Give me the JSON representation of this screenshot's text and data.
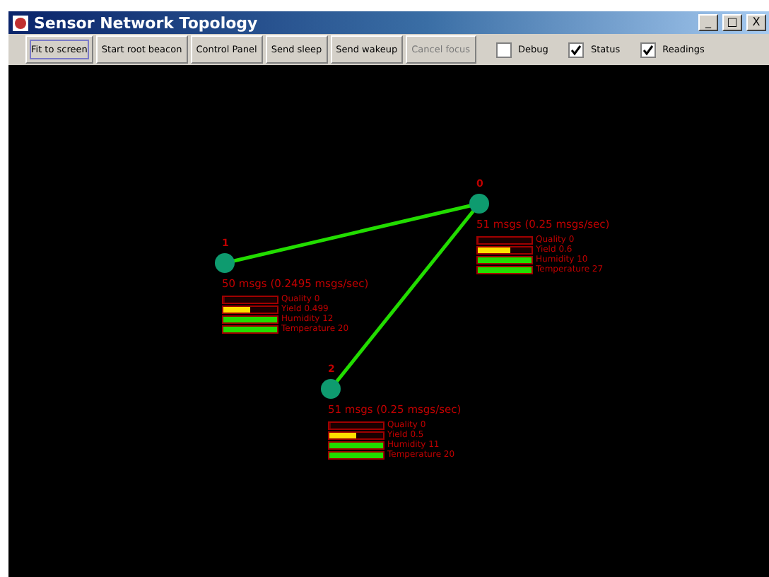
{
  "window": {
    "title": "Sensor Network Topology",
    "controls": [
      "_",
      "□",
      "X"
    ]
  },
  "toolbar": {
    "buttons": [
      {
        "label": "Fit to screen",
        "disabled": false,
        "focused": true
      },
      {
        "label": "Start root beacon",
        "disabled": false,
        "focused": false
      },
      {
        "label": "Control Panel",
        "disabled": false,
        "focused": false
      },
      {
        "label": "Send sleep",
        "disabled": false,
        "focused": false
      },
      {
        "label": "Send wakeup",
        "disabled": false,
        "focused": false
      },
      {
        "label": "Cancel focus",
        "disabled": true,
        "focused": false
      }
    ],
    "checkboxes": [
      {
        "label": "Debug",
        "checked": false
      },
      {
        "label": "Status",
        "checked": true
      },
      {
        "label": "Readings",
        "checked": true
      }
    ]
  },
  "nodes": [
    {
      "id_label": "0",
      "linked": false,
      "rate": "51 msgs (0.25 msgs/sec)",
      "readings": [
        {
          "label": "Quality  0",
          "level": 0
        },
        {
          "label": "Yield  0.6",
          "level": 0.6
        },
        {
          "label": "Humidity   10",
          "level": 1
        },
        {
          "label": "Temperature  27",
          "level": 1
        }
      ]
    },
    {
      "id_label": "1",
      "linked": true,
      "rate": "50 msgs (0.2495 msgs/sec)",
      "readings": [
        {
          "label": "Quality  0",
          "level": 0
        },
        {
          "label": "Yield  0.499",
          "level": 0.5
        },
        {
          "label": "Humidity   12",
          "level": 1
        },
        {
          "label": "Temperature  20",
          "level": 1
        }
      ]
    },
    {
      "id_label": "2",
      "linked": true,
      "rate": "51 msgs (0.25 msgs/sec)",
      "readings": [
        {
          "label": "Quality  0",
          "level": 0
        },
        {
          "label": "Yield  0.5",
          "level": 0.5
        },
        {
          "label": "Humidity   11",
          "level": 1
        },
        {
          "label": "Temperature  20",
          "level": 1
        }
      ]
    }
  ]
}
